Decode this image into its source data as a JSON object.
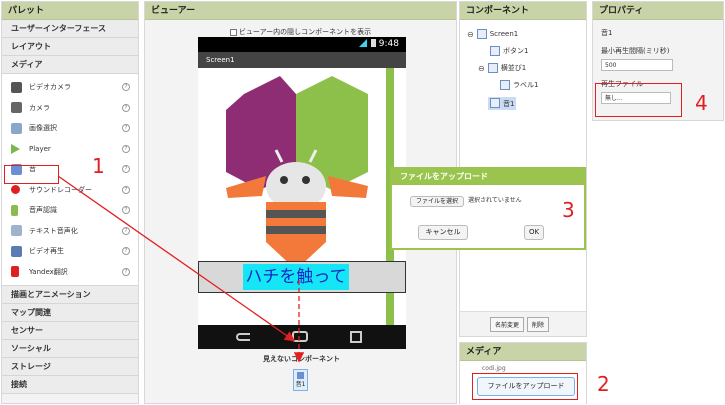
{
  "palette": {
    "title": "パレット",
    "categories_top": [
      "ユーザーインターフェース",
      "レイアウト",
      "メディア"
    ],
    "media_items": [
      {
        "label": "ビデオカメラ",
        "icon": "camcorder-icon"
      },
      {
        "label": "カメラ",
        "icon": "camera-icon"
      },
      {
        "label": "画像選択",
        "icon": "image-picker-icon"
      },
      {
        "label": "Player",
        "icon": "player-icon"
      },
      {
        "label": "音",
        "icon": "sound-icon"
      },
      {
        "label": "サウンドレコーダー",
        "icon": "record-icon"
      },
      {
        "label": "音声認識",
        "icon": "mic-icon"
      },
      {
        "label": "テキスト音声化",
        "icon": "text-to-speech-icon"
      },
      {
        "label": "ビデオ再生",
        "icon": "video-player-icon"
      },
      {
        "label": "Yandex翻訳",
        "icon": "yandex-icon"
      }
    ],
    "categories_bottom": [
      "描画とアニメーション",
      "マップ関連",
      "センサー",
      "ソーシャル",
      "ストレージ",
      "接続"
    ],
    "help_glyph": "?"
  },
  "viewer": {
    "title": "ビューアー",
    "show_hidden_label": "ビューアー内の隠しコンポーネントを表示",
    "status_time": "9:48",
    "screen_title": "Screen1",
    "label_text": "ハチを触って",
    "invisible_components_label": "見えないコンポーネント",
    "sound_component": "音1"
  },
  "components": {
    "title": "コンポーネント",
    "tree": [
      "Screen1",
      "ボタン1",
      "横並び1",
      "ラベル1",
      "音1"
    ],
    "rename_button": "名前変更",
    "delete_button": "削除"
  },
  "media": {
    "title": "メディア",
    "file_name": "codi.jpg",
    "upload_button": "ファイルをアップロード"
  },
  "properties": {
    "title": "プロパティ",
    "component": "音1",
    "min_interval_label": "最小再生間隔(ミリ秒)",
    "min_interval_value": "500",
    "source_label": "再生ファイル",
    "source_value": "無し..."
  },
  "dialog": {
    "title": "ファイルをアップロード",
    "choose_file_button": "ファイルを選択",
    "no_file_text": "選択されていません",
    "cancel_button": "キャンセル",
    "ok_button": "OK"
  },
  "annotations": {
    "num1": "1",
    "num2": "2",
    "num3": "3",
    "num4": "4"
  },
  "colors": {
    "accent_green": "#9ac44d",
    "annotation_red": "#e21f1f",
    "label_bg": "#14e6f6",
    "label_text": "#1428c8"
  }
}
